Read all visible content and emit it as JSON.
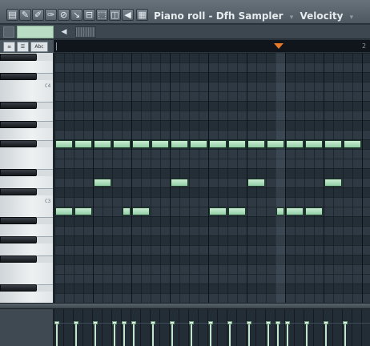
{
  "toolbar": {
    "title": "Piano roll - Dfh Sampler",
    "sep_icon": "▾",
    "target": "Velocity",
    "tools": [
      {
        "name": "piano-roll-menu-icon",
        "glyph": "▤"
      },
      {
        "name": "wrench-icon",
        "glyph": "✎"
      },
      {
        "name": "pencil-icon",
        "glyph": "✐"
      },
      {
        "name": "paint-brush-icon",
        "glyph": "✑"
      },
      {
        "name": "delete-tool-icon",
        "glyph": "⊘"
      },
      {
        "name": "mute-tool-icon",
        "glyph": "↘"
      },
      {
        "name": "slice-tool-icon",
        "glyph": "⊟"
      },
      {
        "name": "select-tool-icon",
        "glyph": "⬚"
      },
      {
        "name": "zoom-tool-icon",
        "glyph": "◫"
      },
      {
        "name": "playback-tool-icon",
        "glyph": "◀"
      },
      {
        "name": "snap-grid-icon",
        "glyph": "▦"
      }
    ]
  },
  "ruler": {
    "bar_number": "2",
    "playhead_color": "#e8792b"
  },
  "keyboard": {
    "labels": [
      "C4",
      "C3"
    ]
  },
  "notes_color": "#a9dcb8",
  "notes": [
    {
      "row": 9,
      "start": 0,
      "len": 2
    },
    {
      "row": 9,
      "start": 2,
      "len": 2
    },
    {
      "row": 9,
      "start": 4,
      "len": 2
    },
    {
      "row": 9,
      "start": 6,
      "len": 2
    },
    {
      "row": 9,
      "start": 8,
      "len": 2
    },
    {
      "row": 9,
      "start": 10,
      "len": 2
    },
    {
      "row": 9,
      "start": 12,
      "len": 2
    },
    {
      "row": 9,
      "start": 14,
      "len": 2
    },
    {
      "row": 9,
      "start": 16,
      "len": 2
    },
    {
      "row": 9,
      "start": 18,
      "len": 2
    },
    {
      "row": 9,
      "start": 20,
      "len": 2
    },
    {
      "row": 9,
      "start": 22,
      "len": 2
    },
    {
      "row": 9,
      "start": 24,
      "len": 2
    },
    {
      "row": 9,
      "start": 26,
      "len": 2
    },
    {
      "row": 9,
      "start": 28,
      "len": 2
    },
    {
      "row": 9,
      "start": 30,
      "len": 2
    },
    {
      "row": 13,
      "start": 4,
      "len": 2
    },
    {
      "row": 13,
      "start": 12,
      "len": 2
    },
    {
      "row": 13,
      "start": 20,
      "len": 2
    },
    {
      "row": 13,
      "start": 28,
      "len": 2
    },
    {
      "row": 16,
      "start": 0,
      "len": 2
    },
    {
      "row": 16,
      "start": 2,
      "len": 2
    },
    {
      "row": 16,
      "start": 7,
      "len": 1
    },
    {
      "row": 16,
      "start": 8,
      "len": 2
    },
    {
      "row": 16,
      "start": 16,
      "len": 2
    },
    {
      "row": 16,
      "start": 18,
      "len": 2
    },
    {
      "row": 16,
      "start": 23,
      "len": 1
    },
    {
      "row": 16,
      "start": 24,
      "len": 2
    },
    {
      "row": 16,
      "start": 26,
      "len": 2
    }
  ]
}
